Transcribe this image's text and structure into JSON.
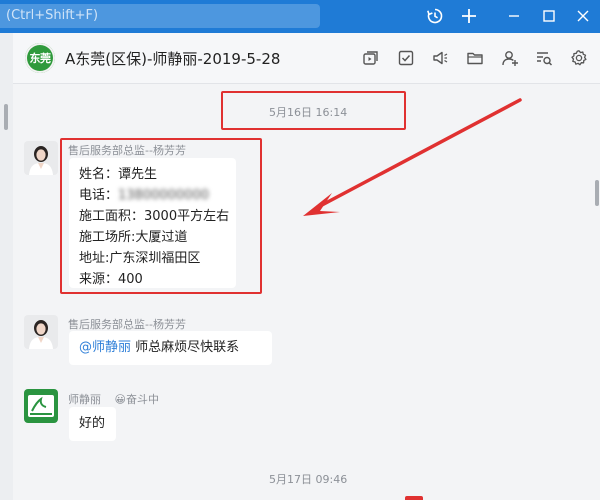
{
  "titlebar": {
    "search_placeholder": "(Ctrl+Shift+F)",
    "buttons": [
      "history-icon",
      "add-icon",
      "minimize-icon",
      "maximize-icon",
      "close-icon"
    ]
  },
  "chat": {
    "group_avatar_text": "东莞",
    "title": "A东莞(区保)-师静丽-2019-5-28",
    "header_icons": [
      "screen-share-icon",
      "task-icon",
      "announce-icon",
      "folder-icon",
      "add-member-icon",
      "search-history-icon",
      "settings-icon"
    ]
  },
  "messages": {
    "time1": "5月16日 16:14",
    "msg1": {
      "sender": "售后服务部总监--杨芳芳",
      "lines": [
        "姓名：谭先生",
        "电话：13800000000",
        "施工面积：3000平方左右",
        "施工场所:大厦过道",
        "地址:广东深圳福田区",
        "来源：400"
      ],
      "phone_label": "电话：",
      "phone_blurred": "13800000000"
    },
    "msg2": {
      "sender": "售后服务部总监--杨芳芳",
      "mention": "@师静丽",
      "text": " 师总麻烦尽快联系"
    },
    "msg3": {
      "sender": "师静丽",
      "status_emoji": "😀",
      "status": "奋斗中",
      "text": "好的"
    },
    "time2": "5月17日 09:46"
  },
  "colors": {
    "titlebar": "#1f7bd6",
    "highlight": "#e03131",
    "mention": "#2f7fd8"
  }
}
